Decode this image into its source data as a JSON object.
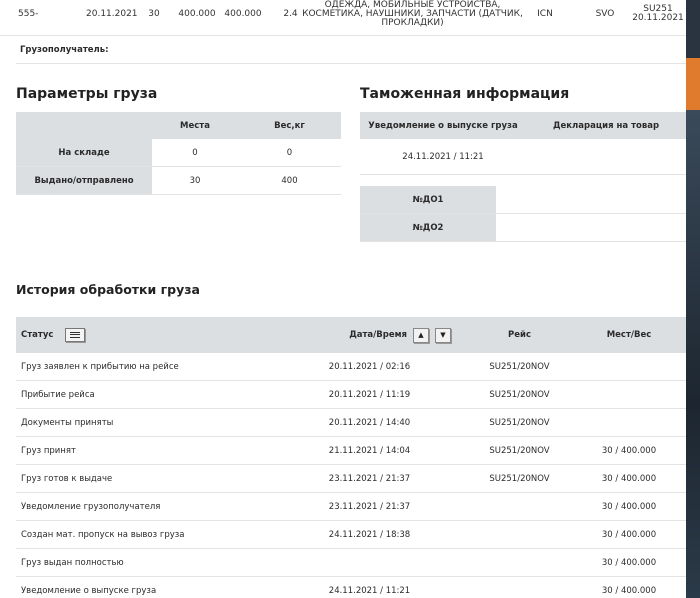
{
  "shipment": {
    "awb": "555-",
    "date": "20.11.2021",
    "pieces": "30",
    "weight1": "400.000",
    "weight2": "400.000",
    "volume": "2.4",
    "description_line1": "ОДЕЖДА, МОБИЛЬНЫЕ УСТРОЙСТВА,",
    "description_line2": "КОСМЕТИКА, НАУШНИКИ, ЗАПЧАСТИ (ДАТЧИК,",
    "description_line3": "ПРОКЛАДКИ)",
    "origin": "ICN",
    "destination": "SVO",
    "flight": "SU251",
    "flight_date": "20.11.2021"
  },
  "consignee_label": "Грузополучатель:",
  "cargo_params": {
    "title": "Параметры груза",
    "col_pieces": "Места",
    "col_weight": "Вес,кг",
    "rows": [
      {
        "label": "На складе",
        "pieces": "0",
        "weight": "0"
      },
      {
        "label": "Выдано/отправлено",
        "pieces": "30",
        "weight": "400"
      }
    ]
  },
  "customs": {
    "title": "Таможенная информация",
    "col_release": "Уведомление о выпуске груза",
    "col_declaration": "Декларация на товар",
    "release_value": "24.11.2021 / 11:21",
    "declaration_value": "",
    "docs": [
      {
        "label": "№ДО1",
        "value": ""
      },
      {
        "label": "№ДО2",
        "value": ""
      }
    ]
  },
  "history": {
    "title": "История обработки груза",
    "col_status": "Статус",
    "col_datetime": "Дата/Время",
    "col_flight": "Рейс",
    "col_pieces_weight": "Мест/Вес",
    "sort_up": "▲",
    "sort_down": "▼",
    "rows": [
      {
        "status": "Груз заявлен к прибытию на рейсе",
        "datetime": "20.11.2021 / 02:16",
        "flight": "SU251/20NOV",
        "pw": ""
      },
      {
        "status": "Прибытие рейса",
        "datetime": "20.11.2021 / 11:19",
        "flight": "SU251/20NOV",
        "pw": ""
      },
      {
        "status": "Документы приняты",
        "datetime": "20.11.2021 / 14:40",
        "flight": "SU251/20NOV",
        "pw": ""
      },
      {
        "status": "Груз принят",
        "datetime": "21.11.2021 / 14:04",
        "flight": "SU251/20NOV",
        "pw": "30 / 400.000"
      },
      {
        "status": "Груз готов к выдаче",
        "datetime": "23.11.2021 / 21:37",
        "flight": "SU251/20NOV",
        "pw": "30 / 400.000"
      },
      {
        "status": "Уведомление грузополучателя",
        "datetime": "23.11.2021 / 21:37",
        "flight": "",
        "pw": "30 / 400.000"
      },
      {
        "status": "Создан мат. пропуск на вывоз груза",
        "datetime": "24.11.2021 / 18:38",
        "flight": "",
        "pw": "30 / 400.000"
      },
      {
        "status": "Груз выдан полностью",
        "datetime": "",
        "flight": "",
        "pw": "30 / 400.000"
      },
      {
        "status": "Уведомление о выпуске груза",
        "datetime": "24.11.2021 / 11:21",
        "flight": "",
        "pw": "30 / 400.000"
      }
    ]
  }
}
